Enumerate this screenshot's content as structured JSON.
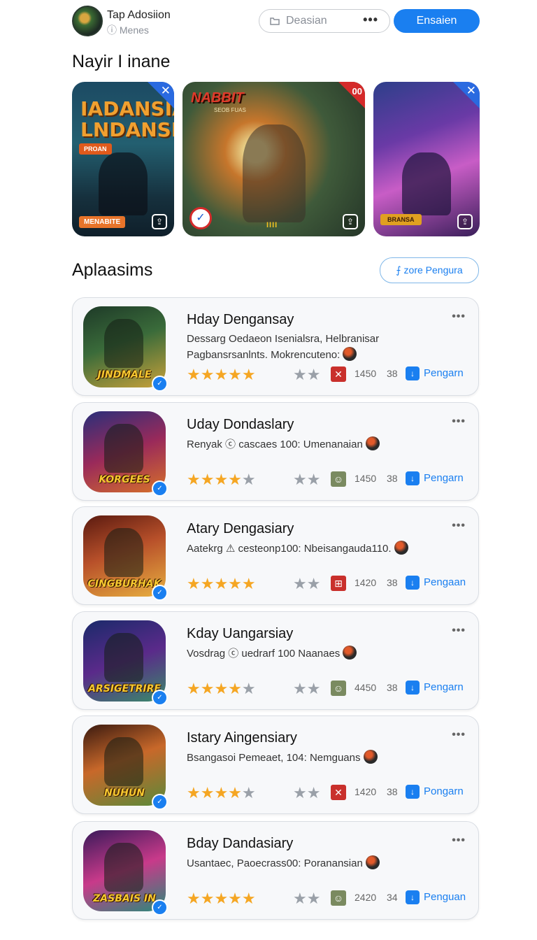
{
  "header": {
    "app_name": "Tap Adosiion",
    "app_sub": "ⓘ Menes",
    "search_placeholder": "Deasian",
    "search_more": "•••",
    "primary_button": "Ensaien"
  },
  "featured": {
    "title": "Nayir I inane",
    "items": [
      {
        "title_line1": "IADANSIA",
        "title_line2": "LNDANSIA",
        "tag": "PROAN",
        "tag2": "MENABITE",
        "close": "✕"
      },
      {
        "logo": "NABBIT",
        "sublogo": "SEOB FUAS",
        "corner": "00",
        "bars": "IIII"
      },
      {
        "tag": "BRANSA",
        "close": "✕"
      }
    ]
  },
  "apps": {
    "title": "Aplaasims",
    "more_button": "⨍ zore Pengura",
    "items": [
      {
        "title": "Hday Dengansay",
        "desc": "Dessarg Oedaeon Isenialsra, Helbranisar Pagbansrsanlnts. Mokrencuteno:",
        "count": "1450",
        "num": "38",
        "action": "Pengarn",
        "icon_text": "JINDMALE",
        "rating": 5,
        "chip": "✕"
      },
      {
        "title": "Uday Dondaslary",
        "desc": "Renyak ⓒ cascaes 100: Umenanaian",
        "count": "1450",
        "num": "38",
        "action": "Pengarn",
        "icon_text": "KORGEES",
        "rating": 4,
        "chip": "☺"
      },
      {
        "title": "Atary Dengasiary",
        "desc": "Aatekrg ⚠ cesteonp100: Nbeisangauda110.",
        "count": "1420",
        "num": "38",
        "action": "Pengaan",
        "icon_text": "CINGBURHAK",
        "rating": 5,
        "chip": "⊞"
      },
      {
        "title": "Kday Uangarsiay",
        "desc": "Vosdrag ⓒ uedrarf 100 Naanaes",
        "count": "4450",
        "num": "38",
        "action": "Pengarn",
        "icon_text": "ARSIGETRIRE",
        "rating": 4,
        "chip": "☺"
      },
      {
        "title": "Istary Aingensiary",
        "desc": "Bsangasoi Pemeaet, 104: Nemguans",
        "count": "1420",
        "num": "38",
        "action": "Pongarn",
        "icon_text": "NUHUN",
        "rating": 4,
        "chip": "✕"
      },
      {
        "title": "Bday Dandasiary",
        "desc": "Usantaec, Paoecrass00: Poranansian",
        "count": "2420",
        "num": "34",
        "action": "Penguan",
        "icon_text": "ZASBAIS IN",
        "rating": 5,
        "chip": "☺"
      }
    ]
  },
  "colors": {
    "accent": "#1a7ff0",
    "star": "#f5a623",
    "card_bg": "#f7f8fa"
  }
}
